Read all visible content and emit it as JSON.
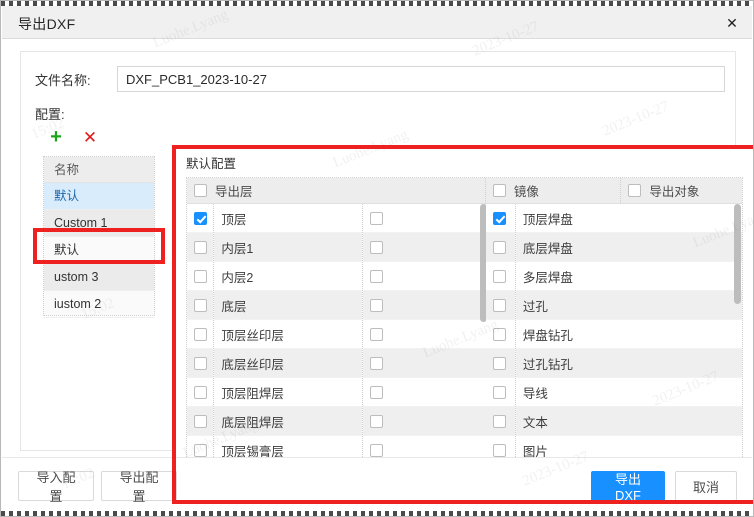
{
  "window": {
    "title": "导出DXF",
    "close_icon": "close-icon"
  },
  "form": {
    "filename_label": "文件名称:",
    "filename_value": "DXF_PCB1_2023-10-27",
    "filename_placeholder": "",
    "config_label": "配置:"
  },
  "config_toolbar": {
    "add_icon": "plus-icon",
    "add_glyph": "+",
    "delete_icon": "cross-icon",
    "delete_glyph": "✕"
  },
  "config_list": {
    "header": "名称",
    "items": [
      {
        "label": "默认",
        "selected": true
      },
      {
        "label": "Custom 1",
        "selected": false
      },
      {
        "label": "默认",
        "selected": false
      },
      {
        "label": "ustom 3",
        "selected": false
      },
      {
        "label": "iustom 2",
        "selected": false
      }
    ]
  },
  "default_config": {
    "title": "默认配置",
    "columns": {
      "layer": "导出层",
      "mirror": "镜像",
      "object": "导出对象"
    },
    "header_checks": {
      "layer": false,
      "mirror": false,
      "object": false
    },
    "layers": [
      {
        "name": "顶层",
        "checked": true,
        "mirror": false
      },
      {
        "name": "内层1",
        "checked": false,
        "mirror": false
      },
      {
        "name": "内层2",
        "checked": false,
        "mirror": false
      },
      {
        "name": "底层",
        "checked": false,
        "mirror": false
      },
      {
        "name": "顶层丝印层",
        "checked": false,
        "mirror": false
      },
      {
        "name": "底层丝印层",
        "checked": false,
        "mirror": false
      },
      {
        "name": "顶层阻焊层",
        "checked": false,
        "mirror": false
      },
      {
        "name": "底层阻焊层",
        "checked": false,
        "mirror": false
      },
      {
        "name": "顶层锡膏层",
        "checked": false,
        "mirror": false
      }
    ],
    "objects": [
      {
        "name": "顶层焊盘",
        "checked": true
      },
      {
        "name": "底层焊盘",
        "checked": false
      },
      {
        "name": "多层焊盘",
        "checked": false
      },
      {
        "name": "过孔",
        "checked": false
      },
      {
        "name": "焊盘钻孔",
        "checked": false
      },
      {
        "name": "过孔钻孔",
        "checked": false
      },
      {
        "name": "导线",
        "checked": false
      },
      {
        "name": "文本",
        "checked": false
      },
      {
        "name": "图片",
        "checked": false
      }
    ]
  },
  "footer": {
    "import_config": "导入配置",
    "export_config": "导出配置",
    "export_dxf": "导出DXF",
    "cancel": "取消"
  },
  "colors": {
    "accent": "#1890ff",
    "highlight_box": "#ef2020",
    "add_icon": "#18a818",
    "delete_icon": "#e01b1b",
    "selected_row": "#d9ecfb"
  },
  "watermarks": [
    "Luohe.Lyang",
    "2023-10-27",
    "15:02",
    "Luohe.Lyang",
    "2023-10-27",
    "15:02",
    "Luohe.Lyang",
    "2023-10-27"
  ]
}
